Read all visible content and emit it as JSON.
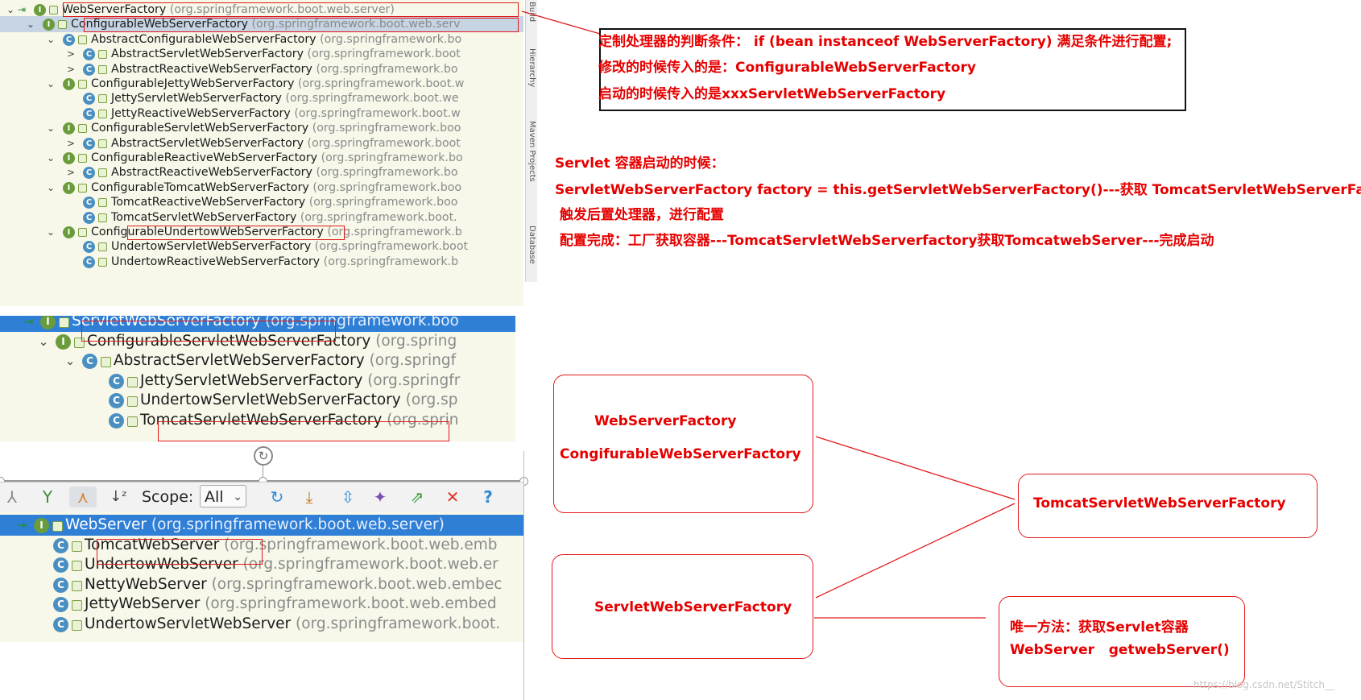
{
  "hierarchy1": {
    "rows": [
      {
        "indent": 0,
        "arrow": "⌄",
        "kind": "I",
        "nav": true,
        "name": "WebServerFactory",
        "pkg": "(org.springframework.boot.web.server)"
      },
      {
        "indent": 1,
        "arrow": "⌄",
        "kind": "I",
        "name": "ConfigurableWebServerFactory",
        "pkg": "(org.springframework.boot.web.serv"
      },
      {
        "indent": 2,
        "arrow": "⌄",
        "kind": "C",
        "name": "AbstractConfigurableWebServerFactory",
        "pkg": "(org.springframework.bo"
      },
      {
        "indent": 3,
        "arrow": ">",
        "kind": "C",
        "name": "AbstractServletWebServerFactory",
        "pkg": "(org.springframework.boot"
      },
      {
        "indent": 3,
        "arrow": ">",
        "kind": "C",
        "name": "AbstractReactiveWebServerFactory",
        "pkg": "(org.springframework.bo"
      },
      {
        "indent": 2,
        "arrow": "⌄",
        "kind": "I",
        "name": "ConfigurableJettyWebServerFactory",
        "pkg": "(org.springframework.boot.w"
      },
      {
        "indent": 3,
        "arrow": "",
        "kind": "C",
        "name": "JettyServletWebServerFactory",
        "pkg": "(org.springframework.boot.we"
      },
      {
        "indent": 3,
        "arrow": "",
        "kind": "C",
        "name": "JettyReactiveWebServerFactory",
        "pkg": "(org.springframework.boot.w"
      },
      {
        "indent": 2,
        "arrow": "⌄",
        "kind": "I",
        "name": "ConfigurableServletWebServerFactory",
        "pkg": "(org.springframework.boo"
      },
      {
        "indent": 3,
        "arrow": ">",
        "kind": "C",
        "name": "AbstractServletWebServerFactory",
        "pkg": "(org.springframework.boot"
      },
      {
        "indent": 2,
        "arrow": "⌄",
        "kind": "I",
        "name": "ConfigurableReactiveWebServerFactory",
        "pkg": "(org.springframework.bo"
      },
      {
        "indent": 3,
        "arrow": ">",
        "kind": "C",
        "name": "AbstractReactiveWebServerFactory",
        "pkg": "(org.springframework.bo"
      },
      {
        "indent": 2,
        "arrow": "⌄",
        "kind": "I",
        "name": "ConfigurableTomcatWebServerFactory",
        "pkg": "(org.springframework.boo"
      },
      {
        "indent": 3,
        "arrow": "",
        "kind": "C",
        "name": "TomcatReactiveWebServerFactory",
        "pkg": "(org.springframework.boo"
      },
      {
        "indent": 3,
        "arrow": "",
        "kind": "C",
        "name": "TomcatServletWebServerFactory",
        "pkg": "(org.springframework.boot."
      },
      {
        "indent": 2,
        "arrow": "⌄",
        "kind": "I",
        "name": "ConfigurableUndertowWebServerFactory",
        "pkg": "(org.springframework.b"
      },
      {
        "indent": 3,
        "arrow": "",
        "kind": "C",
        "name": "UndertowServletWebServerFactory",
        "pkg": "(org.springframework.boot"
      },
      {
        "indent": 3,
        "arrow": "",
        "kind": "C",
        "name": "UndertowReactiveWebServerFactory",
        "pkg": "(org.springframework.b"
      }
    ],
    "side_tabs": [
      "Build",
      "Hierarchy",
      "Maven Projects",
      "Database"
    ]
  },
  "hierarchy2": {
    "rows": [
      {
        "indent": 0,
        "arrow": "",
        "kind": "I",
        "nav": true,
        "name": "ServletWebServerFactory",
        "pkg": "(org.springframework.boo"
      },
      {
        "indent": 1,
        "arrow": "⌄",
        "kind": "I",
        "name": "ConfigurableServletWebServerFactory",
        "pkg": "(org.spring"
      },
      {
        "indent": 2,
        "arrow": "⌄",
        "kind": "C",
        "name": "AbstractServletWebServerFactory",
        "pkg": "(org.springf"
      },
      {
        "indent": 3,
        "arrow": "",
        "kind": "C",
        "name": "JettyServletWebServerFactory",
        "pkg": "(org.springfr"
      },
      {
        "indent": 3,
        "arrow": "",
        "kind": "C",
        "name": "UndertowServletWebServerFactory",
        "pkg": "(org.sp"
      },
      {
        "indent": 3,
        "arrow": "",
        "kind": "C",
        "name": "TomcatServletWebServerFactory",
        "pkg": "(org.sprin"
      }
    ]
  },
  "toolbar": {
    "icons": [
      "hierarchy-icon",
      "supertypes-icon",
      "subtypes-icon",
      "sort-alpha-icon"
    ],
    "scope_label": "Scope:",
    "scope_value": "All",
    "icons_right": [
      "refresh-icon",
      "export-icon",
      "expand-all-icon",
      "pin-icon",
      "open-tab-icon",
      "close-icon",
      "help-icon"
    ],
    "pressed_index": 2
  },
  "hierarchy3": {
    "rows": [
      {
        "indent": 0,
        "arrow": "",
        "kind": "I",
        "nav": true,
        "name": "WebServer",
        "pkg": "(org.springframework.boot.web.server)"
      },
      {
        "indent": 1,
        "arrow": "",
        "kind": "C",
        "name": "TomcatWebServer",
        "pkg": "(org.springframework.boot.web.emb"
      },
      {
        "indent": 1,
        "arrow": "",
        "kind": "C",
        "name": "UndertowWebServer",
        "pkg": "(org.springframework.boot.web.er"
      },
      {
        "indent": 1,
        "arrow": "",
        "kind": "C",
        "name": "NettyWebServer",
        "pkg": "(org.springframework.boot.web.embec"
      },
      {
        "indent": 1,
        "arrow": "",
        "kind": "C",
        "name": "JettyWebServer",
        "pkg": "(org.springframework.boot.web.embed"
      },
      {
        "indent": 1,
        "arrow": "",
        "kind": "C",
        "name": "UndertowServletWebServer",
        "pkg": "(org.springframework.boot."
      }
    ]
  },
  "annotations": {
    "box1": [
      "定制处理器的判断条件：  if (bean instanceof WebServerFactory) 满足条件进行配置;",
      "修改的时候传入的是：ConfigurableWebServerFactory",
      "启动的时候传入的是xxxServletWebServerFactory"
    ],
    "servlet_notes": [
      "Servlet 容器启动的时候：",
      "ServletWebServerFactory factory = this.getServletWebServerFactory()---获取 TomcatServletWebServerFactory",
      " 触发后置处理器，进行配置",
      " 配置完成：工厂获取容器---TomcatServletWebServerfactory获取TomcatwebServer---完成启动"
    ],
    "node_factories": [
      "WebServerFactory",
      "CongifurableWebServerFactory"
    ],
    "node_tomcat": "TomcatServletWebServerFactory",
    "node_servlet": "ServletWebServerFactory",
    "node_method": [
      "唯一方法：获取Servlet容器",
      "WebServer   getwebServer()"
    ]
  },
  "watermark": "https://blog.csdn.net/Stitch__",
  "colors": {
    "annotation": "#e60000",
    "selection_blue": "#2f7fd6",
    "selection_gray": "#c6d4e4",
    "tree_bg": "#f7f8e9"
  }
}
